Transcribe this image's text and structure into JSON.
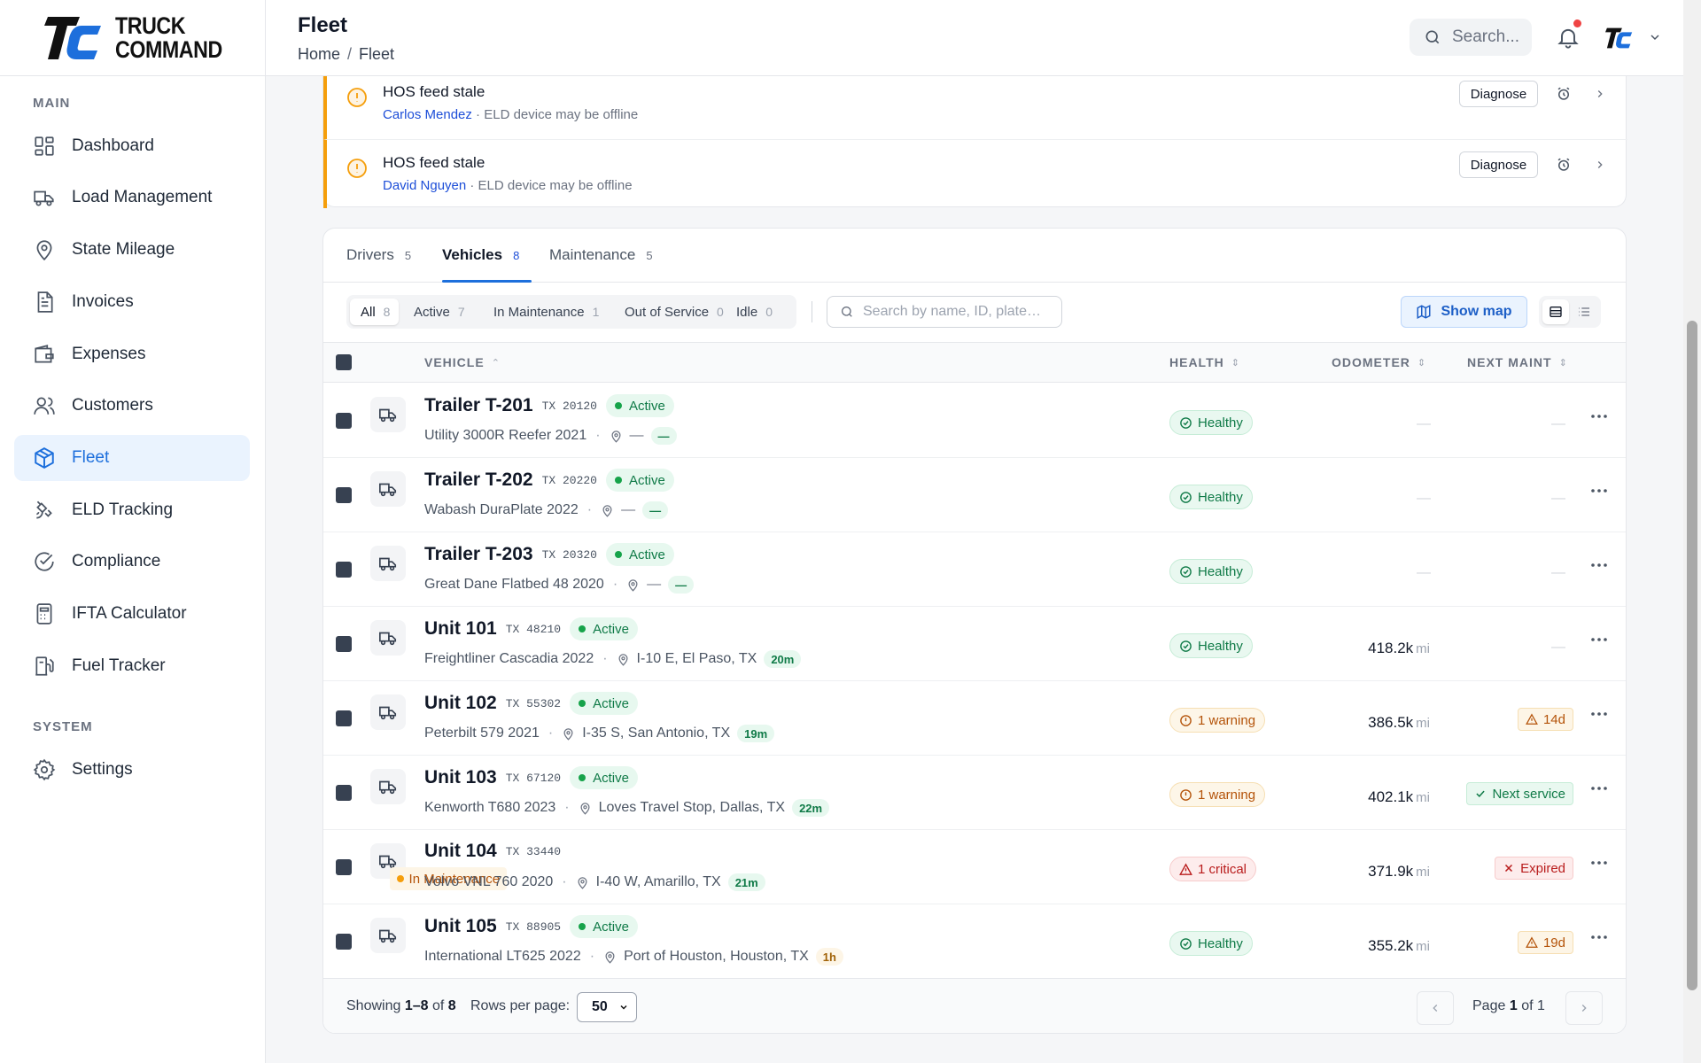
{
  "brand": {
    "line1": "TRUCK",
    "line2": "COMMAND"
  },
  "sidebar": {
    "section_main": "MAIN",
    "section_system": "SYSTEM",
    "items": [
      {
        "label": "Dashboard",
        "icon": "dashboard-icon"
      },
      {
        "label": "Load Management",
        "icon": "truck-icon"
      },
      {
        "label": "State Mileage",
        "icon": "map-pin-icon"
      },
      {
        "label": "Invoices",
        "icon": "document-icon"
      },
      {
        "label": "Expenses",
        "icon": "wallet-icon"
      },
      {
        "label": "Customers",
        "icon": "users-icon"
      },
      {
        "label": "Fleet",
        "icon": "box-icon",
        "active": true
      },
      {
        "label": "ELD Tracking",
        "icon": "satellite-icon"
      },
      {
        "label": "Compliance",
        "icon": "check-circle-icon"
      },
      {
        "label": "IFTA Calculator",
        "icon": "calculator-icon"
      },
      {
        "label": "Fuel Tracker",
        "icon": "fuel-icon"
      }
    ],
    "system_items": [
      {
        "label": "Settings",
        "icon": "gear-icon"
      }
    ]
  },
  "header": {
    "title": "Fleet",
    "breadcrumb": [
      "Home",
      "Fleet"
    ],
    "breadcrumb_sep": "/",
    "search_placeholder": "Search..."
  },
  "alerts": [
    {
      "title": "HOS feed stale",
      "driver": "Carlos Mendez",
      "detail": " · ELD device may be offline",
      "action": "Diagnose"
    },
    {
      "title": "HOS feed stale",
      "driver": "David Nguyen",
      "detail": " · ELD device may be offline",
      "action": "Diagnose"
    }
  ],
  "tabs": [
    {
      "label": "Drivers",
      "count": "5"
    },
    {
      "label": "Vehicles",
      "count": "8",
      "active": true
    },
    {
      "label": "Maintenance",
      "count": "5"
    }
  ],
  "filters": [
    {
      "label": "All",
      "count": "8",
      "active": true
    },
    {
      "label": "Active",
      "count": "7"
    },
    {
      "label": "In Maintenance",
      "count": "1"
    },
    {
      "label": "Out of Service",
      "count": "0"
    },
    {
      "label": "Idle",
      "count": "0"
    }
  ],
  "table_search_placeholder": "Search by name, ID, plate…",
  "show_map_label": "Show map",
  "columns": {
    "vehicle": "VEHICLE",
    "health": "HEALTH",
    "odometer": "ODOMETER",
    "next_maint": "NEXT MAINT"
  },
  "rows": [
    {
      "name": "Trailer T-201",
      "plate": "TX 20120",
      "status": "Active",
      "model": "Utility 3000R Reefer 2021",
      "location": "—",
      "age": "—",
      "health": "Healthy",
      "odometer": "—",
      "odo_unit": "",
      "maint": "—"
    },
    {
      "name": "Trailer T-202",
      "plate": "TX 20220",
      "status": "Active",
      "model": "Wabash DuraPlate 2022",
      "location": "—",
      "age": "—",
      "health": "Healthy",
      "odometer": "—",
      "odo_unit": "",
      "maint": "—"
    },
    {
      "name": "Trailer T-203",
      "plate": "TX 20320",
      "status": "Active",
      "model": "Great Dane Flatbed 48 2020",
      "location": "—",
      "age": "—",
      "health": "Healthy",
      "odometer": "—",
      "odo_unit": "",
      "maint": "—"
    },
    {
      "name": "Unit 101",
      "plate": "TX 48210",
      "status": "Active",
      "model": "Freightliner Cascadia 2022",
      "location": "I-10 E, El Paso, TX",
      "age": "20m",
      "health": "Healthy",
      "odometer": "418.2k",
      "odo_unit": "mi",
      "maint": "—"
    },
    {
      "name": "Unit 102",
      "plate": "TX 55302",
      "status": "Active",
      "model": "Peterbilt 579 2021",
      "location": "I-35 S, San Antonio, TX",
      "age": "19m",
      "health": "1 warning",
      "odometer": "386.5k",
      "odo_unit": "mi",
      "maint": "14d"
    },
    {
      "name": "Unit 103",
      "plate": "TX 67120",
      "status": "Active",
      "model": "Kenworth T680 2023",
      "location": "Loves Travel Stop, Dallas, TX",
      "age": "22m",
      "health": "1 warning",
      "odometer": "402.1k",
      "odo_unit": "mi",
      "maint": "Next service"
    },
    {
      "name": "Unit 104",
      "plate": "TX 33440",
      "status": "In Maintenance",
      "model": "Volvo VNL 760 2020",
      "location": "I-40 W, Amarillo, TX",
      "age": "21m",
      "health": "1 critical",
      "odometer": "371.9k",
      "odo_unit": "mi",
      "maint": "Expired"
    },
    {
      "name": "Unit 105",
      "plate": "TX 88905",
      "status": "Active",
      "model": "International LT625 2022",
      "location": "Port of Houston, Houston, TX",
      "age": "1h",
      "health": "Healthy",
      "odometer": "355.2k",
      "odo_unit": "mi",
      "maint": "19d"
    }
  ],
  "footer": {
    "showing_prefix": "Showing",
    "showing_range": "1–8",
    "showing_of": "of",
    "showing_total": "8",
    "rows_per_page_label": "Rows per page:",
    "rows_per_page": "50",
    "page_prefix": "Page",
    "page_current": "1",
    "page_of": "of",
    "page_total": "1"
  },
  "colors": {
    "accent": "#1d6fdc",
    "warning": "#f59e0b",
    "success": "#16a34a",
    "danger": "#b91c1c"
  }
}
